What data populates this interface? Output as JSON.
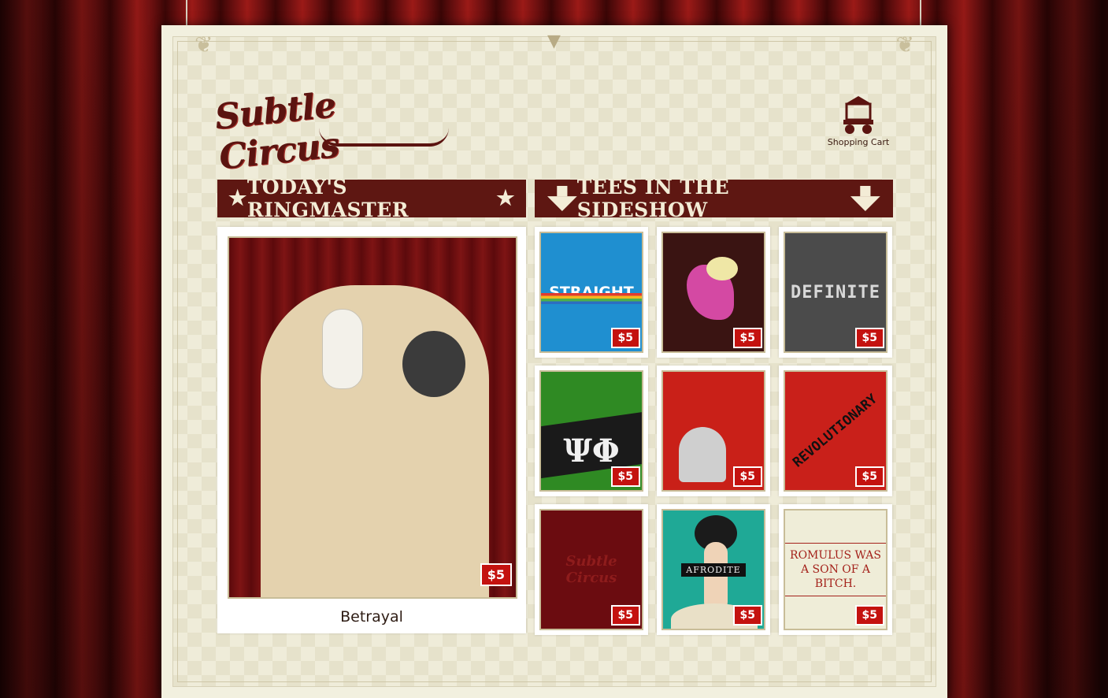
{
  "brand": {
    "logo_text": "Subtle Circus"
  },
  "header": {
    "cart_label": "Shopping Cart"
  },
  "sections": {
    "featured_title": "TODAY'S RINGMASTER",
    "grid_title": "TEES IN THE SIDESHOW"
  },
  "featured": {
    "name": "Betrayal",
    "price": "$5"
  },
  "tees": [
    {
      "art_text": "STRAIGHT",
      "price": "$5"
    },
    {
      "art_text": "",
      "price": "$5"
    },
    {
      "art_text": "DEFINITE",
      "price": "$5"
    },
    {
      "art_text": "ΨΦ",
      "price": "$5"
    },
    {
      "art_text": "",
      "price": "$5"
    },
    {
      "art_text": "REVOLUTIONARY",
      "price": "$5"
    },
    {
      "art_text": "Subtle Circus",
      "price": "$5"
    },
    {
      "art_text": "AFRODITE",
      "price": "$5"
    },
    {
      "art_text": "ROMULUS WAS A SON OF A BITCH.",
      "price": "$5"
    }
  ],
  "icons": [
    "star-icon",
    "arrow-down-icon",
    "shopping-cart-icon"
  ],
  "colors": {
    "banner": "#5e1712",
    "price_tag": "#c4120f",
    "page_bg": "#f2f0df"
  }
}
